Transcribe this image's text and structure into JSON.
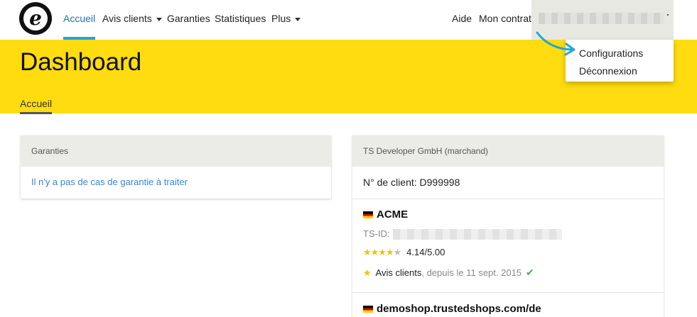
{
  "nav": {
    "logo_letter": "e",
    "items": [
      {
        "label": "Accueil"
      },
      {
        "label": "Avis clients"
      },
      {
        "label": "Garanties"
      },
      {
        "label": "Statistiques"
      },
      {
        "label": "Plus"
      }
    ],
    "right_items": [
      {
        "label": "Aide"
      },
      {
        "label": "Mon contrat"
      }
    ]
  },
  "dropdown": {
    "items": [
      {
        "label": "Configurations"
      },
      {
        "label": "Déconnexion"
      }
    ]
  },
  "header": {
    "title": "Dashboard",
    "breadcrumb": "Accueil"
  },
  "guarantees_card": {
    "title": "Garanties",
    "message": "Il n'y a pas de cas de garantie à traiter"
  },
  "merchant_card": {
    "title": "TS Developer GmbH (marchand)",
    "client_number": "N° de client: D999998",
    "shops": [
      {
        "name": "ACME",
        "ts_id_label": "TS-ID:",
        "rating": "4.14/5.00",
        "reviews_label": "Avis clients",
        "reviews_since": ", depuis le 11 sept. 2015"
      },
      {
        "name": "demoshop.trustedshops.com/de"
      }
    ]
  },
  "colors": {
    "header_yellow": "#ffdc0f",
    "active_nav": "#1a73b5",
    "accent_underline": "#1fa4d6",
    "link": "#3a86c8",
    "star": "#f2c200",
    "check": "#4cae4c"
  }
}
